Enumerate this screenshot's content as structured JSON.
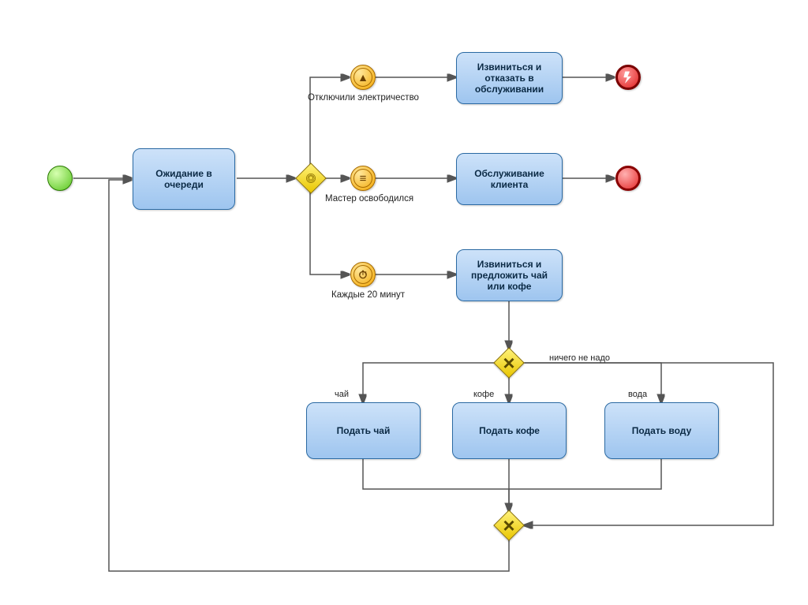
{
  "tasks": {
    "wait": "Ожидание в очереди",
    "apologize_refuse": "Извиниться и отказать в обслуживании",
    "serve_client": "Обслуживание клиента",
    "apologize_offer": "Извиниться и предложить чай или кофе",
    "serve_tea": "Подать чай",
    "serve_coffee": "Подать кофе",
    "serve_water": "Подать воду"
  },
  "event_labels": {
    "electricity_off": "Отключили электричество",
    "master_free": "Мастер освободился",
    "every_20": "Каждые 20 минут"
  },
  "edge_labels": {
    "tea": "чай",
    "coffee": "кофе",
    "water": "вода",
    "nothing": "ничего не надо"
  },
  "icons": {
    "error": "⚡",
    "timer": "⏱",
    "list": "≡",
    "arrow_up": "▲"
  }
}
